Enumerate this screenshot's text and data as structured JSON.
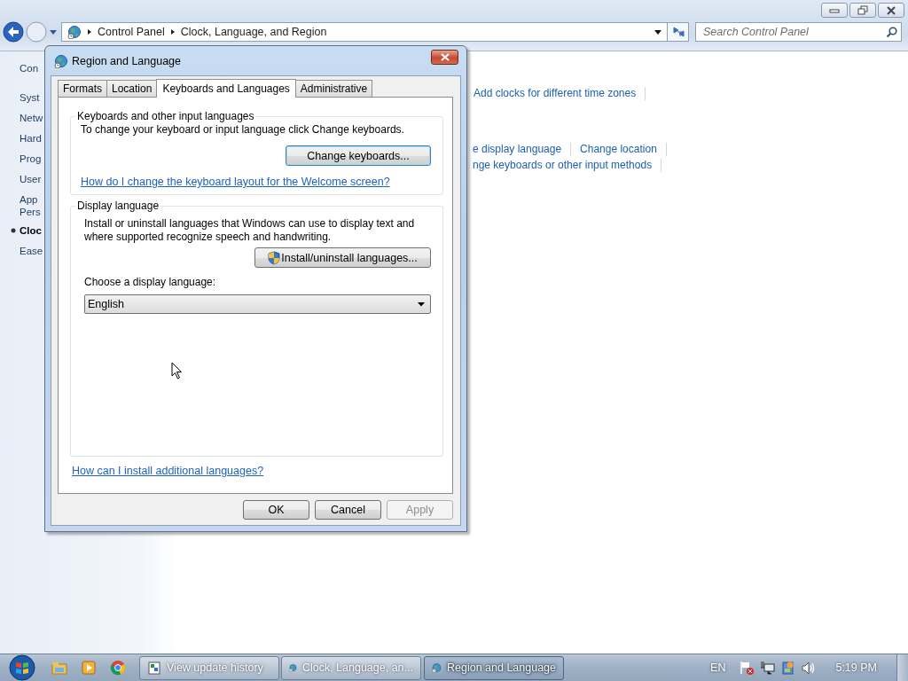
{
  "window": {
    "breadcrumb": [
      "Control Panel",
      "Clock, Language, and Region"
    ],
    "search": {
      "placeholder": "Search Control Panel"
    }
  },
  "sidebar": {
    "items": [
      {
        "label": "Con",
        "selected": false
      },
      {
        "label": "Syst",
        "selected": false
      },
      {
        "label": "Netw",
        "selected": false
      },
      {
        "label": "Hard",
        "selected": false
      },
      {
        "label": "Prog",
        "selected": false
      },
      {
        "label": "User",
        "selected": false
      },
      {
        "label": "App\nPers",
        "selected": false
      },
      {
        "label": "Cloc",
        "selected": true
      },
      {
        "label": "Ease",
        "selected": false
      }
    ]
  },
  "content": {
    "link_rows": [
      [
        "Add clocks for different time zones"
      ],
      [
        "e display language",
        "Change location"
      ],
      [
        "nge keyboards or other input methods"
      ]
    ]
  },
  "dialog": {
    "title": "Region and Language",
    "tabs": [
      {
        "label": "Formats",
        "selected": false
      },
      {
        "label": "Location",
        "selected": false
      },
      {
        "label": "Keyboards and Languages",
        "selected": true
      },
      {
        "label": "Administrative",
        "selected": false
      }
    ],
    "keyboards_group": {
      "legend": "Keyboards and other input languages",
      "text": "To change your keyboard or input language click Change keyboards.",
      "button": "Change keyboards...",
      "link": "How do I change the keyboard layout for the Welcome screen?"
    },
    "display_group": {
      "legend": "Display language",
      "text": "Install or uninstall languages that Windows can use to display text and where supported recognize speech and handwriting.",
      "button": "Install/uninstall languages...",
      "choose_label": "Choose a display language:",
      "select_value": "English"
    },
    "footer_link": "How can I install additional languages?",
    "buttons": [
      {
        "label": "OK",
        "disabled": false
      },
      {
        "label": "Cancel",
        "disabled": false
      },
      {
        "label": "Apply",
        "disabled": true
      }
    ]
  },
  "taskbar": {
    "tasks": [
      {
        "label": "View update history",
        "selected": false
      },
      {
        "label": "Clock, Language, an...",
        "selected": false
      },
      {
        "label": "Region and Language",
        "selected": true
      }
    ],
    "language": "EN",
    "time": "5:19 PM"
  }
}
